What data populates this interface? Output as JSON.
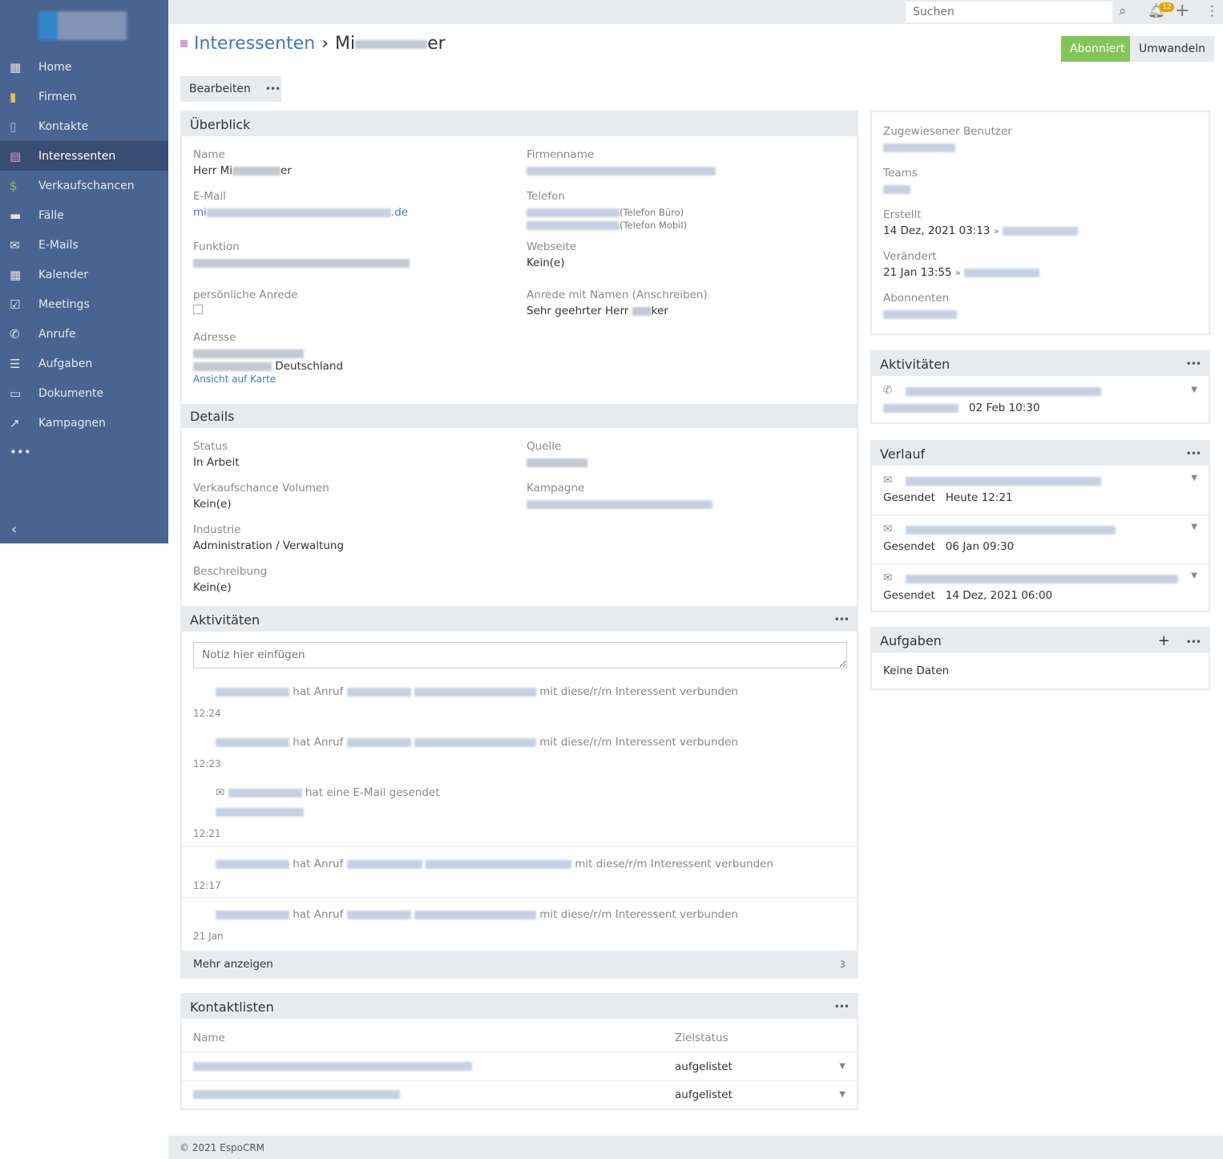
{
  "nav": [
    {
      "label": "Home",
      "icon": "home-icon"
    },
    {
      "label": "Firmen",
      "icon": "building-icon"
    },
    {
      "label": "Kontakte",
      "icon": "contact-card-icon"
    },
    {
      "label": "Interessenten",
      "icon": "address-card-icon"
    },
    {
      "label": "Verkaufschancen",
      "icon": "dollar-icon"
    },
    {
      "label": "Fälle",
      "icon": "briefcase-icon"
    },
    {
      "label": "E-Mails",
      "icon": "envelope-icon"
    },
    {
      "label": "Kalender",
      "icon": "calendar-icon"
    },
    {
      "label": "Meetings",
      "icon": "calendar-check-icon"
    },
    {
      "label": "Anrufe",
      "icon": "phone-icon"
    },
    {
      "label": "Aufgaben",
      "icon": "tasks-icon"
    },
    {
      "label": "Dokumente",
      "icon": "document-icon"
    },
    {
      "label": "Kampagnen",
      "icon": "chart-icon"
    }
  ],
  "topbar": {
    "search_placeholder": "Suchen",
    "notifications": "12"
  },
  "header": {
    "breadcrumb": "Interessenten",
    "sep": "›",
    "name_start": "Mi",
    "name_end": "er",
    "subscribed": "Abonniert",
    "convert": "Umwandeln",
    "edit": "Bearbeiten"
  },
  "overview": {
    "title": "Überblick",
    "name_label": "Name",
    "name_start": "Herr Mi",
    "name_end": "er",
    "company_label": "Firmenname",
    "email_label": "E-Mail",
    "email_start": "mi",
    "email_end": ".de",
    "phone_label": "Telefon",
    "phone1_type": "(Telefon Büro)",
    "phone2_type": "(Telefon Mobil)",
    "function_label": "Funktion",
    "website_label": "Webseite",
    "website_value": "Kein(e)",
    "salutation_label": "persönliche Anrede",
    "salutation_name_label": "Anrede mit Namen (Anschreiben)",
    "salutation_name_start": "Sehr geehrter Herr",
    "salutation_name_end": "ker",
    "address_label": "Adresse",
    "country": "Deutschland",
    "map_link": "Ansicht auf Karte"
  },
  "details": {
    "title": "Details",
    "status_label": "Status",
    "status": "In Arbeit",
    "source_label": "Quelle",
    "volume_label": "Verkaufschance Volumen",
    "volume": "Kein(e)",
    "campaign_label": "Kampagne",
    "industry_label": "Industrie",
    "industry": "Administration / Verwaltung",
    "description_label": "Beschreibung",
    "description": "Kein(e)"
  },
  "stream": {
    "title": "Aktivitäten",
    "placeholder": "Notiz hier einfügen",
    "call_text": "hat Anruf",
    "linked_text": "mit diese/r/m Interessent verbunden",
    "email_text": "hat eine E-Mail gesendet",
    "times": [
      "12:24",
      "12:23",
      "12:21",
      "12:17",
      "21 Jan"
    ],
    "more": "Mehr anzeigen",
    "more_count": "3"
  },
  "lists": {
    "title": "Kontaktlisten",
    "col_name": "Name",
    "col_status": "Zielstatus",
    "rows": [
      {
        "status": "aufgelistet"
      },
      {
        "status": "aufgelistet"
      }
    ]
  },
  "side": {
    "assigned_label": "Zugewiesener Benutzer",
    "teams_label": "Teams",
    "created_label": "Erstellt",
    "created": "14 Dez, 2021 03:13",
    "modified_label": "Verändert",
    "modified": "21 Jan 13:55",
    "followers_label": "Abonnenten"
  },
  "activities": {
    "title": "Aktivitäten",
    "date": "02 Feb 10:30"
  },
  "history": {
    "title": "Verlauf",
    "items": [
      {
        "status": "Gesendet",
        "date": "Heute 12:21"
      },
      {
        "status": "Gesendet",
        "date": "06 Jan 09:30"
      },
      {
        "status": "Gesendet",
        "date": "14 Dez, 2021 06:00"
      }
    ]
  },
  "tasks": {
    "title": "Aufgaben",
    "empty": "Keine Daten"
  },
  "footer": "© 2021 EspoCRM"
}
